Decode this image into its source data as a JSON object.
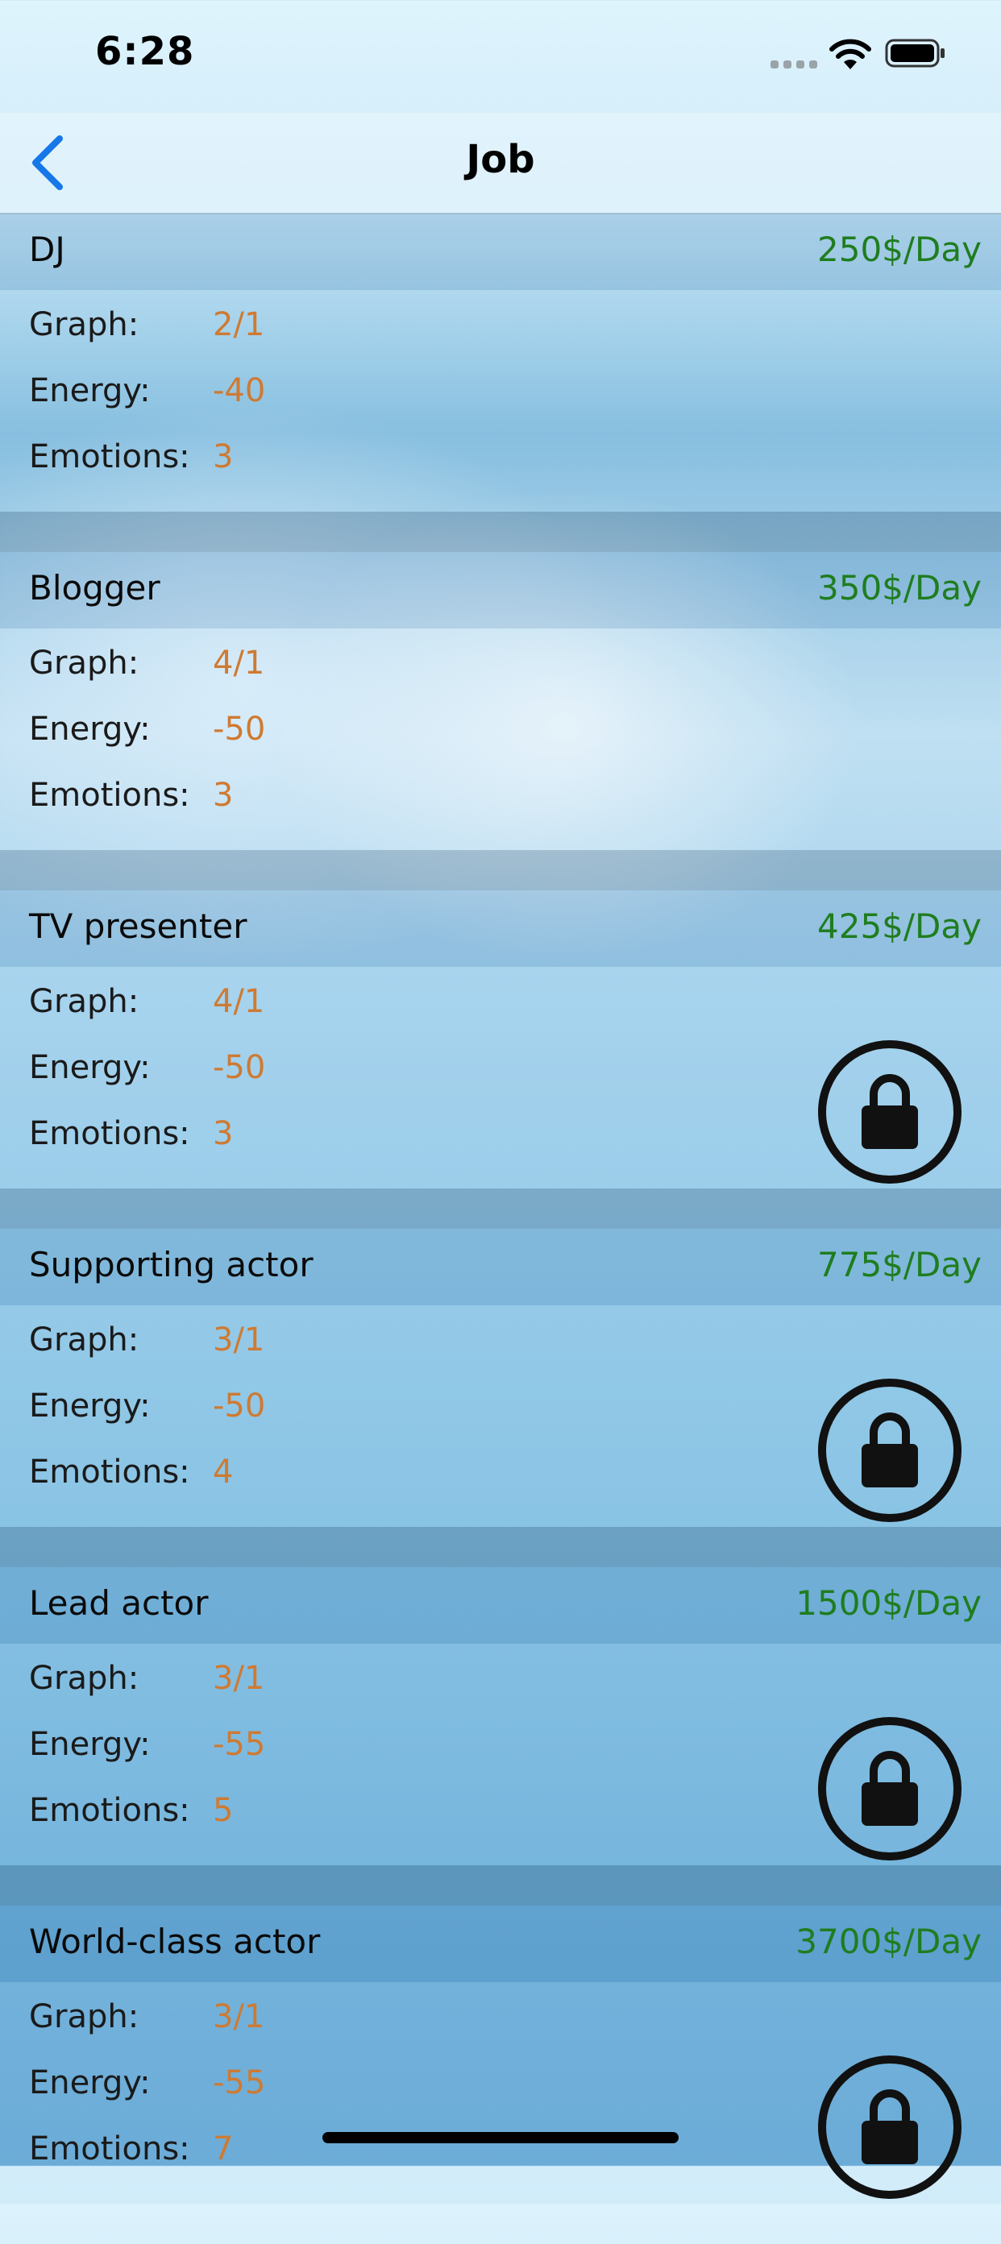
{
  "status": {
    "time": "6:28"
  },
  "nav": {
    "title": "Job"
  },
  "labels": {
    "graph": "Graph:",
    "energy": "Energy:",
    "emotions": "Emotions:"
  },
  "jobs": [
    {
      "name": "DJ",
      "pay": "250$/Day",
      "graph": "2/1",
      "energy": "-40",
      "emotions": "3",
      "locked": false
    },
    {
      "name": "Blogger",
      "pay": "350$/Day",
      "graph": "4/1",
      "energy": "-50",
      "emotions": "3",
      "locked": false
    },
    {
      "name": "TV presenter",
      "pay": "425$/Day",
      "graph": "4/1",
      "energy": "-50",
      "emotions": "3",
      "locked": true
    },
    {
      "name": "Supporting actor",
      "pay": "775$/Day",
      "graph": "3/1",
      "energy": "-50",
      "emotions": "4",
      "locked": true
    },
    {
      "name": "Lead actor",
      "pay": "1500$/Day",
      "graph": "3/1",
      "energy": "-55",
      "emotions": "5",
      "locked": true
    },
    {
      "name": "World-class actor",
      "pay": "3700$/Day",
      "graph": "3/1",
      "energy": "-55",
      "emotions": "7",
      "locked": true
    }
  ],
  "colors": {
    "pay": "#1f7d1f",
    "value": "#cf7a32",
    "accent": "#1677e8"
  }
}
